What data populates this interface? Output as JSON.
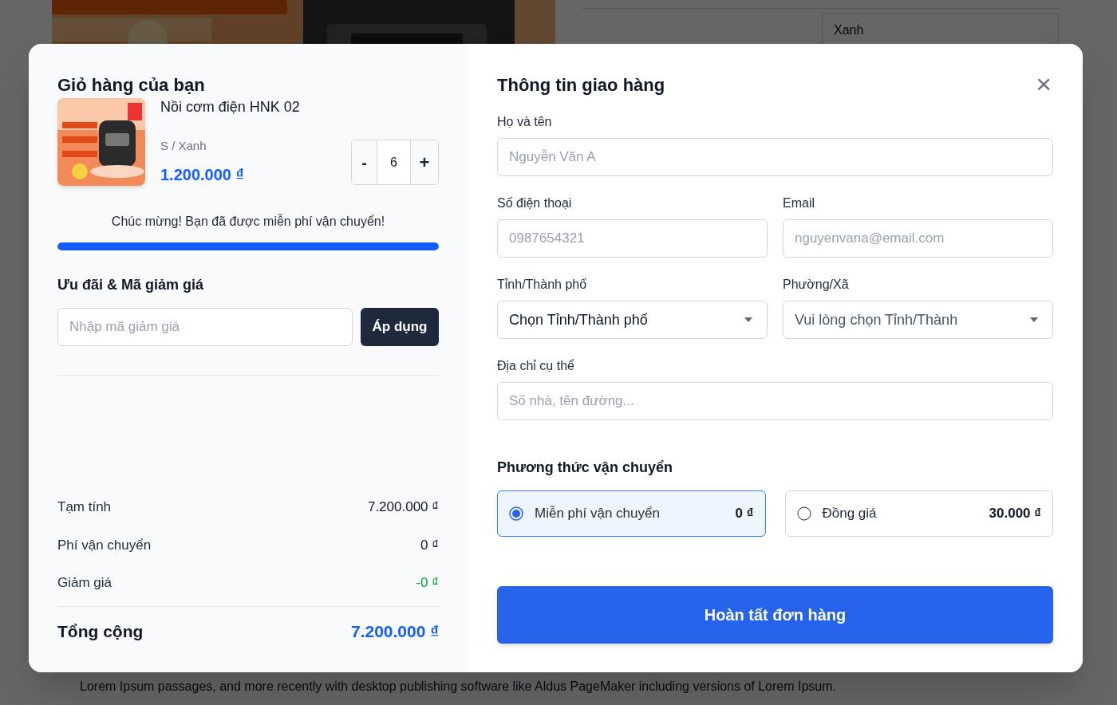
{
  "background_page": {
    "variant_select": {
      "value": "Xanh"
    },
    "paragraph": "Lorem Ipsum passages, and more recently with desktop publishing software like Aldus PageMaker including versions of Lorem Ipsum."
  },
  "cart": {
    "title": "Giỏ hàng của bạn",
    "items": [
      {
        "name": "Nồi cơm điện HNK 02",
        "variant": "S / Xanh",
        "price": "1.200.000 ₫",
        "decrement": "-",
        "quantity": "6",
        "increment": "+"
      }
    ],
    "shipping_progress": {
      "message": "Chúc mừng! Bạn đã được miễn phí vận chuyển!",
      "level": 1
    },
    "discount": {
      "title": "Ưu đãi & Mã giảm giá",
      "placeholder": "Nhập mã giảm giá",
      "button": "Áp dụng"
    },
    "summary": [
      {
        "kind": "normal",
        "label": "Tạm tính",
        "value": "7.200.000 ₫"
      },
      {
        "kind": "normal",
        "label": "Phí vận chuyển",
        "value": "0 ₫"
      },
      {
        "kind": "discount",
        "label": "Giảm giá",
        "value": "-0 ₫"
      },
      {
        "kind": "total",
        "label": "Tổng cộng",
        "value": "7.200.000 ₫"
      }
    ]
  },
  "shipping": {
    "title": "Thông tin giao hàng",
    "close": "×",
    "fields": [
      {
        "kind": "input",
        "label": "Họ và tên",
        "placeholder": "Nguyễn Văn A",
        "wide": true
      },
      {
        "kind": "input",
        "label": "Số điện thoại",
        "placeholder": "0987654321",
        "wide": false
      },
      {
        "kind": "input",
        "label": "Email",
        "placeholder": "nguyenvana@email.com",
        "wide": false
      },
      {
        "kind": "select",
        "label": "Tỉnh/Thành phố",
        "value": "Chọn Tỉnh/Thành phố",
        "disabled": false,
        "wide": false
      },
      {
        "kind": "select",
        "label": "Phường/Xã",
        "value": "Vui lòng chọn Tỉnh/Thành",
        "disabled": true,
        "wide": false
      },
      {
        "kind": "input",
        "label": "Địa chỉ cụ thể",
        "placeholder": "Số nhà, tên đường...",
        "wide": true
      }
    ],
    "method_title": "Phương thức vận chuyển",
    "methods": [
      {
        "label": "Miễn phí vận chuyển",
        "price": "0 ₫",
        "selected": true
      },
      {
        "label": "Đồng giá",
        "price": "30.000 ₫",
        "selected": false
      }
    ],
    "submit": "Hoàn tất đơn hàng"
  }
}
